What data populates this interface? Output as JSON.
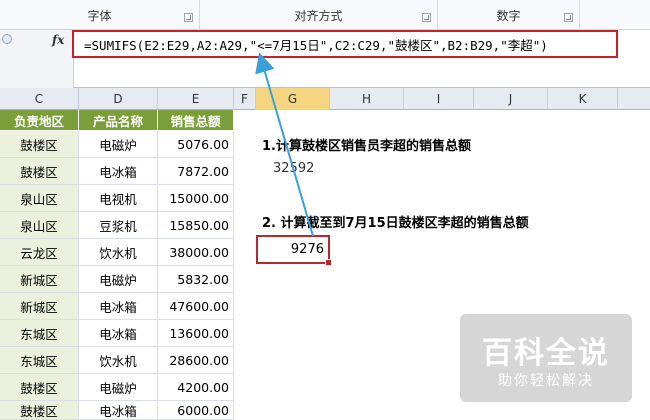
{
  "ribbon": {
    "groups": [
      {
        "label": "字体"
      },
      {
        "label": "对齐方式"
      },
      {
        "label": "数字"
      }
    ]
  },
  "formula_bar": {
    "fx_label": "fx",
    "formula": "=SUMIFS(E2:E29,A2:A29,\"<=7月15日\",C2:C29,\"鼓楼区\",B2:B29,\"李超\")"
  },
  "columns": [
    "C",
    "D",
    "E",
    "F",
    "G",
    "H",
    "I",
    "J",
    "K"
  ],
  "selected_column": "G",
  "table": {
    "headers": [
      "负责地区",
      "产品名称",
      "销售总额"
    ],
    "rows": [
      [
        "鼓楼区",
        "电磁炉",
        "5076.00"
      ],
      [
        "鼓楼区",
        "电冰箱",
        "7872.00"
      ],
      [
        "泉山区",
        "电视机",
        "15000.00"
      ],
      [
        "泉山区",
        "豆浆机",
        "15850.00"
      ],
      [
        "云龙区",
        "饮水机",
        "38000.00"
      ],
      [
        "新城区",
        "电磁炉",
        "5832.00"
      ],
      [
        "新城区",
        "电冰箱",
        "47600.00"
      ],
      [
        "东城区",
        "电冰箱",
        "13600.00"
      ],
      [
        "东城区",
        "饮水机",
        "28600.00"
      ],
      [
        "鼓楼区",
        "电磁炉",
        "4200.00"
      ],
      [
        "鼓楼区",
        "电冰箱",
        "6000.00"
      ]
    ]
  },
  "notes": {
    "q1": "1.计算鼓楼区销售员李超的销售总额",
    "a1": "32592",
    "q2": "2. 计算截至到7月15日鼓楼区李超的销售总额",
    "a2": "9276"
  },
  "watermark": {
    "title": "百科全说",
    "subtitle": "助你轻松解决"
  },
  "colors": {
    "header_green": "#7a9e3a",
    "row_green": "#ebf1dd",
    "highlight_red": "#cc1f26",
    "arrow_blue": "#3aa0d8"
  }
}
